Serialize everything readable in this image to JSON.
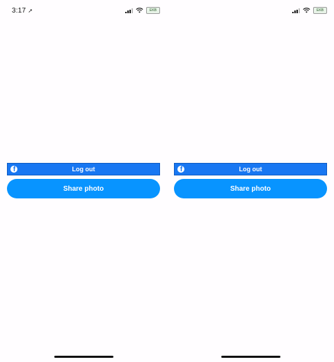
{
  "screens": [
    {
      "status": {
        "time": "3:17",
        "battery": "EKB"
      },
      "fb_button": {
        "label": "Log out",
        "logo": "f"
      },
      "share_button": {
        "label": "Share photo"
      }
    },
    {
      "status": {
        "time": "",
        "battery": "EKB"
      },
      "fb_button": {
        "label": "Log out",
        "logo": "f"
      },
      "share_button": {
        "label": "Share photo"
      }
    }
  ],
  "colors": {
    "facebook_blue": "#1877f2",
    "share_blue": "#0894ff",
    "background": "#fffdff"
  },
  "icons": [
    "location-arrow-icon",
    "signal-icon",
    "wifi-icon",
    "battery-icon",
    "facebook-logo-icon"
  ]
}
